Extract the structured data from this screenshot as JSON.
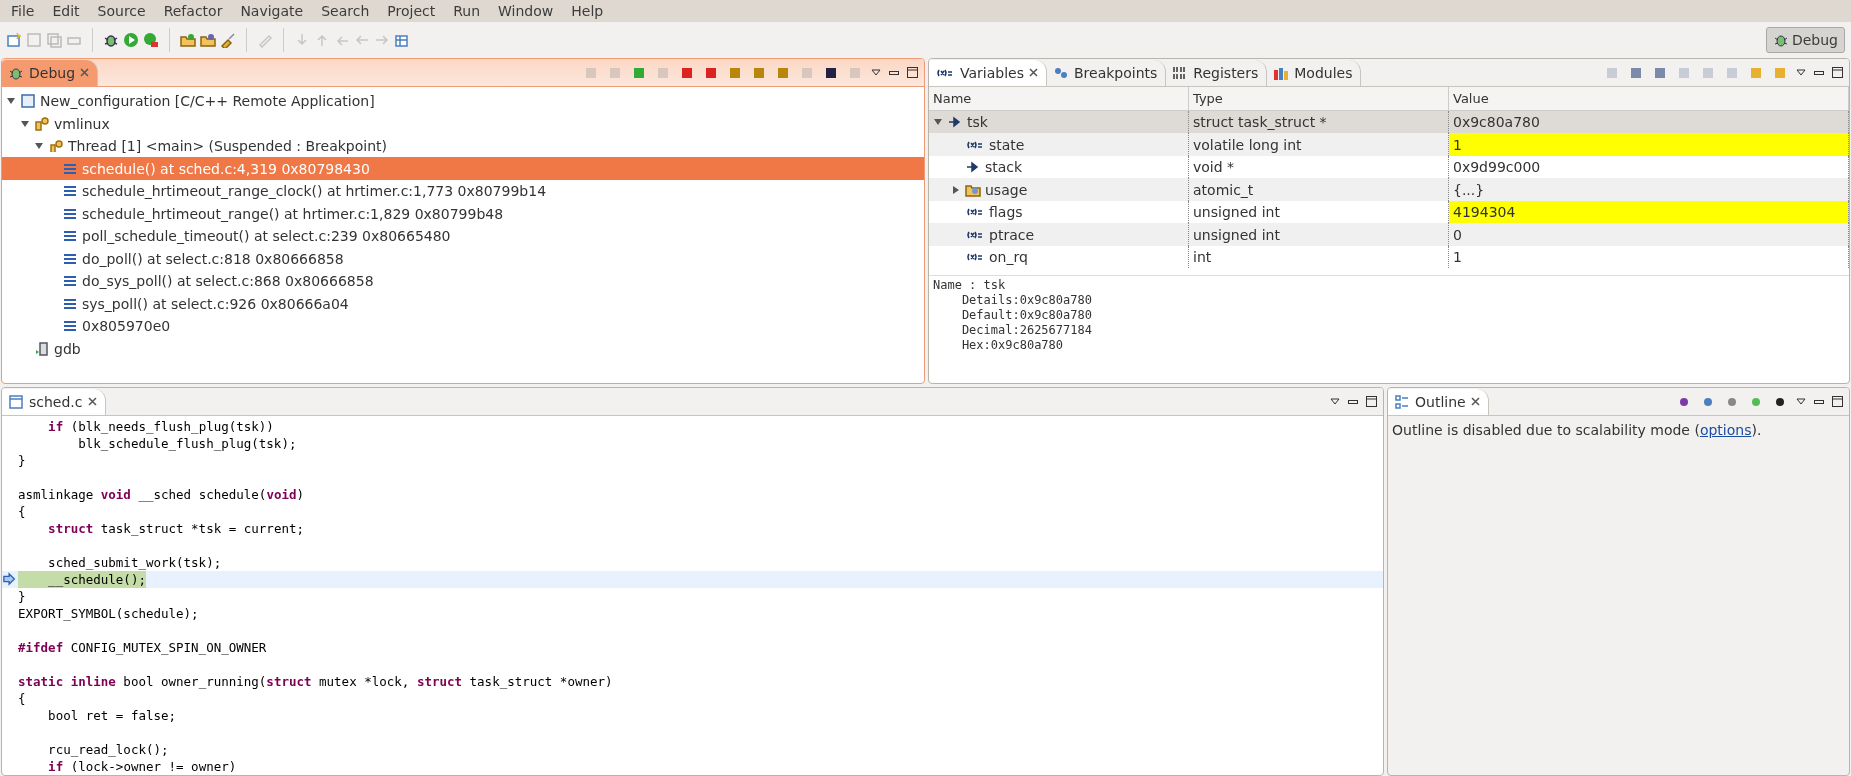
{
  "menu": [
    "File",
    "Edit",
    "Source",
    "Refactor",
    "Navigate",
    "Search",
    "Project",
    "Run",
    "Window",
    "Help"
  ],
  "perspective": {
    "label": "Debug",
    "selected": true
  },
  "debug_view": {
    "title": "Debug",
    "active": true,
    "tree": [
      {
        "label": "New_configuration [C/C++ Remote Application]",
        "kind": "launch",
        "expanded": true,
        "selected": false,
        "children": [
          {
            "label": "vmlinux",
            "kind": "process",
            "expanded": true,
            "selected": false,
            "children": [
              {
                "label": "Thread [1] <main> (Suspended : Breakpoint)",
                "kind": "thread",
                "expanded": true,
                "selected": false,
                "children": [
                  {
                    "label": "schedule() at sched.c:4,319 0x80798430",
                    "kind": "frame",
                    "selected": true
                  },
                  {
                    "label": "schedule_hrtimeout_range_clock() at hrtimer.c:1,773 0x80799b14",
                    "kind": "frame",
                    "selected": false
                  },
                  {
                    "label": "schedule_hrtimeout_range() at hrtimer.c:1,829 0x80799b48",
                    "kind": "frame",
                    "selected": false
                  },
                  {
                    "label": "poll_schedule_timeout() at select.c:239 0x80665480",
                    "kind": "frame",
                    "selected": false
                  },
                  {
                    "label": "do_poll() at select.c:818 0x80666858",
                    "kind": "frame",
                    "selected": false
                  },
                  {
                    "label": "do_sys_poll() at select.c:868 0x80666858",
                    "kind": "frame",
                    "selected": false
                  },
                  {
                    "label": "sys_poll() at select.c:926 0x80666a04",
                    "kind": "frame",
                    "selected": false
                  },
                  {
                    "label": "0x805970e0",
                    "kind": "frame",
                    "selected": false
                  }
                ]
              }
            ]
          },
          {
            "label": "gdb",
            "kind": "gdb",
            "selected": false
          }
        ]
      }
    ]
  },
  "variables_view": {
    "tabs": [
      {
        "label": "Variables",
        "kind": "variables",
        "selected": true
      },
      {
        "label": "Breakpoints",
        "kind": "breakpoints",
        "selected": false
      },
      {
        "label": "Registers",
        "kind": "registers",
        "selected": false
      },
      {
        "label": "Modules",
        "kind": "modules",
        "selected": false
      }
    ],
    "columns": [
      "Name",
      "Type",
      "Value"
    ],
    "rows": [
      {
        "name": "tsk",
        "type": "struct task_struct *",
        "value": "0x9c80a780",
        "kind": "pointer",
        "expanded": true,
        "selected": true,
        "changed": false,
        "children": [
          {
            "name": "state",
            "type": "volatile long int",
            "value": "1",
            "kind": "field",
            "selected": false,
            "changed": true
          },
          {
            "name": "stack",
            "type": "void *",
            "value": "0x9d99c000",
            "kind": "pointer",
            "selected": false,
            "changed": false
          },
          {
            "name": "usage",
            "type": "atomic_t",
            "value": "{...}",
            "kind": "struct",
            "expanded": false,
            "selected": false,
            "changed": false
          },
          {
            "name": "flags",
            "type": "unsigned int",
            "value": "4194304",
            "kind": "field",
            "selected": false,
            "changed": true
          },
          {
            "name": "ptrace",
            "type": "unsigned int",
            "value": "0",
            "kind": "field",
            "selected": false,
            "changed": false
          },
          {
            "name": "on_rq",
            "type": "int",
            "value": "1",
            "kind": "field",
            "selected": false,
            "changed": false
          }
        ]
      }
    ],
    "details": [
      "Name : tsk",
      "    Details:0x9c80a780",
      "    Default:0x9c80a780",
      "    Decimal:2625677184",
      "    Hex:0x9c80a780"
    ]
  },
  "editor": {
    "tab": "sched.c",
    "blocks": [
      [
        {
          "text": "    **if** (blk_needs_flush_plug(tsk))",
          "current": false
        },
        {
          "text": "        blk_schedule_flush_plug(tsk);",
          "current": false
        },
        {
          "text": "}",
          "current": false
        }
      ],
      [
        {
          "text": "asmlinkage **void** __sched schedule(**void**)",
          "current": false
        },
        {
          "text": "{",
          "current": false
        },
        {
          "text": "    **struct** task_struct *tsk = current;",
          "current": false
        }
      ],
      [
        {
          "text": "    sched_submit_work(tsk);",
          "current": false
        },
        {
          "text": "    __schedule();",
          "current": true
        },
        {
          "text": "}",
          "current": false
        },
        {
          "text": "EXPORT_SYMBOL(schedule);",
          "current": false
        }
      ],
      [
        {
          "text": "**#ifdef** CONFIG_MUTEX_SPIN_ON_OWNER",
          "current": false
        }
      ],
      [
        {
          "text": "**static** **inline** bool owner_running(**struct** mutex *lock, **struct** task_struct *owner)",
          "current": false
        },
        {
          "text": "{",
          "current": false
        },
        {
          "text": "    bool ret = false;",
          "current": false
        }
      ],
      [
        {
          "text": "    rcu_read_lock();",
          "current": false
        },
        {
          "text": "    **if** (lock->owner != owner)",
          "current": false
        }
      ]
    ]
  },
  "outline": {
    "title": "Outline",
    "message": "Outline is disabled due to scalability mode (",
    "link": "options",
    "message_end": ")."
  }
}
